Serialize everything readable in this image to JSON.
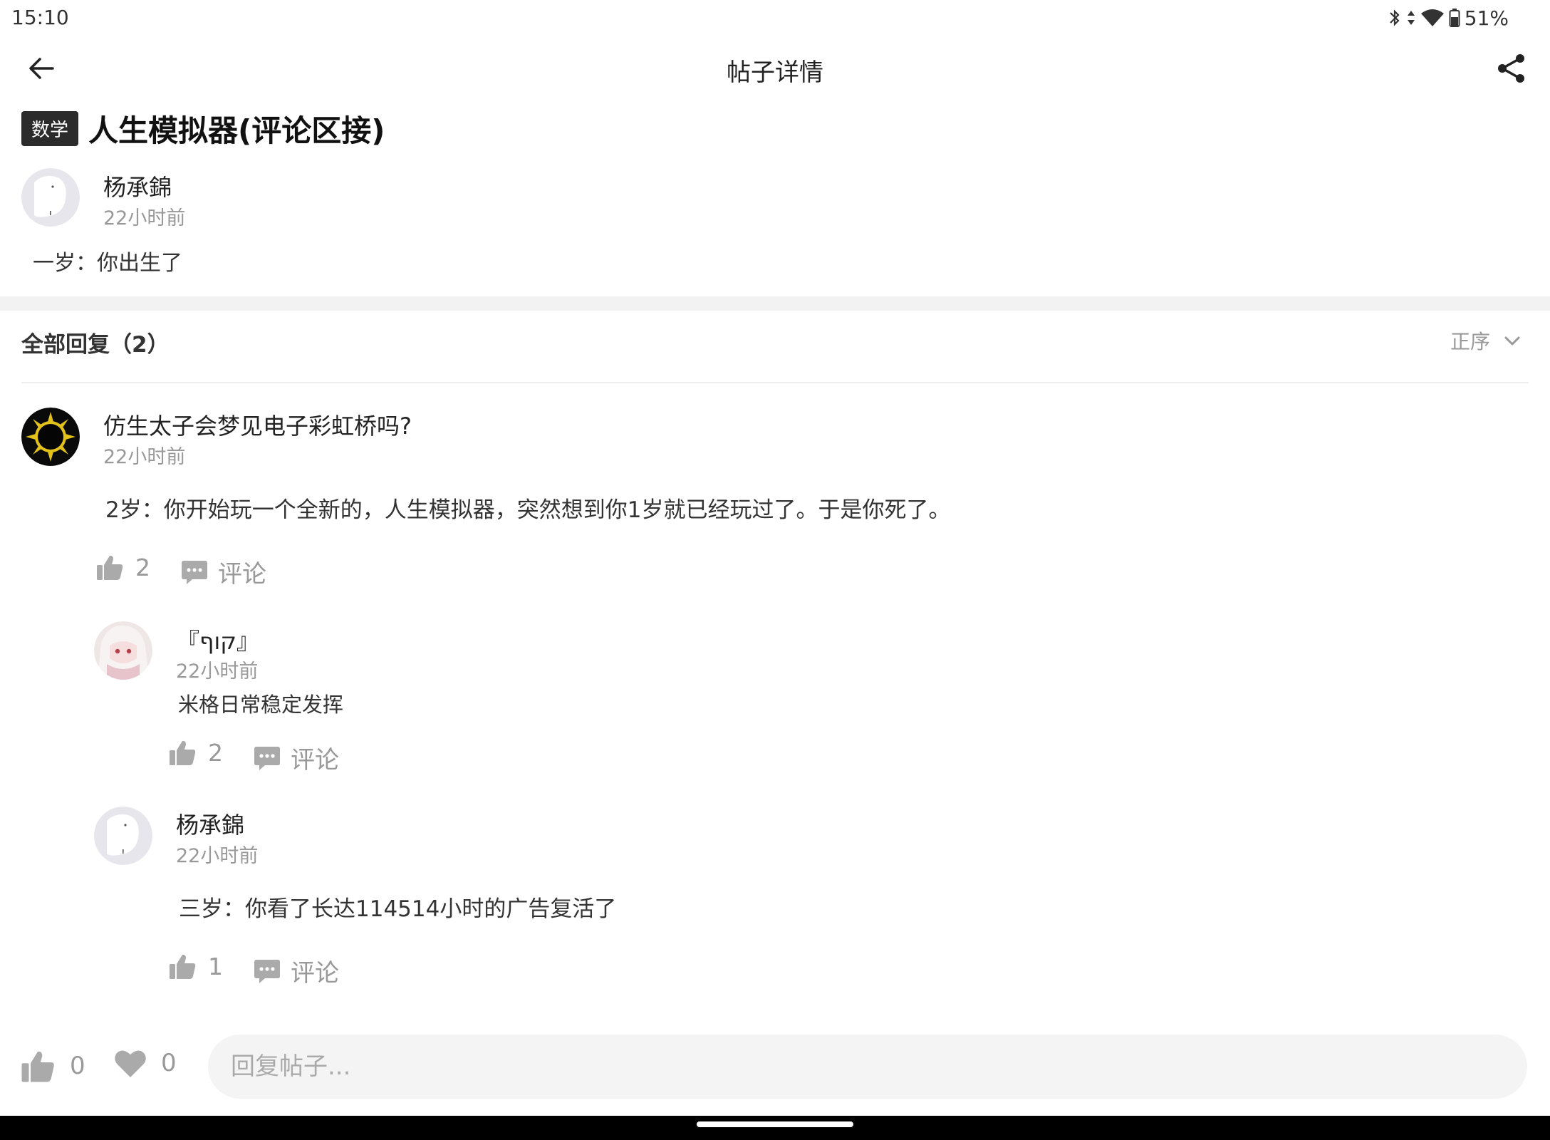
{
  "status_bar": {
    "time": "15:10",
    "battery": "51%",
    "icons": [
      "bluetooth-icon",
      "data-arrows-icon",
      "wifi-icon",
      "battery-icon"
    ]
  },
  "top_bar": {
    "title": "帖子详情",
    "back_icon": "arrow-left-icon",
    "share_icon": "share-icon"
  },
  "post": {
    "tag": "数学",
    "title": "人生模拟器(评论区接)",
    "author": "杨承錦",
    "time": "22小时前",
    "content": "一岁：你出生了"
  },
  "replies": {
    "header": "全部回复（2）",
    "sort_label": "正序",
    "items": [
      {
        "author": "仿生太子会梦见电子彩虹桥吗?",
        "time": "22小时前",
        "content": "2岁：你开始玩一个全新的，人生模拟器，突然想到你1岁就已经玩过了。于是你死了。",
        "likes": "2",
        "comment_label": "评论",
        "sub_replies": [
          {
            "author": "『קוף』",
            "time": "22小时前",
            "content": "米格日常稳定发挥",
            "likes": "2",
            "comment_label": "评论"
          },
          {
            "author": "杨承錦",
            "time": "22小时前",
            "content": "三岁：你看了长达114514小时的广告复活了",
            "likes": "1",
            "comment_label": "评论"
          }
        ]
      }
    ]
  },
  "bottom_bar": {
    "likes": "0",
    "favorites": "0",
    "reply_placeholder": "回复帖子..."
  },
  "colors": {
    "tag_bg": "#2b2b2b",
    "muted": "#999999",
    "divider": "#f2f2f2",
    "input_bg": "#f3f4f3"
  }
}
